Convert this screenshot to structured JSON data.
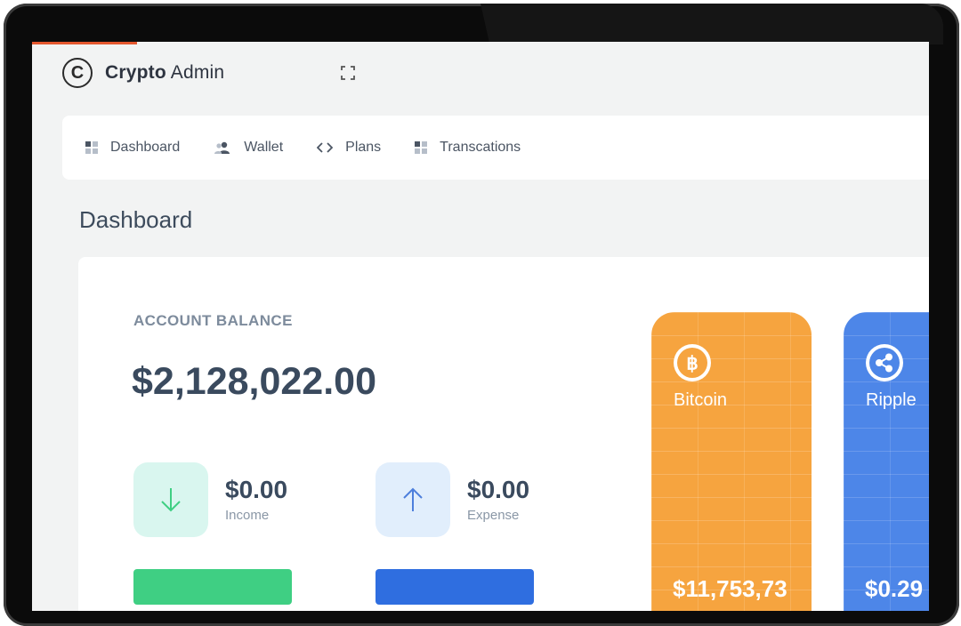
{
  "brand": {
    "name_bold": "Crypto",
    "name_light": "Admin",
    "logo_glyph": "C"
  },
  "header": {
    "fullscreen_icon": "fullscreen-icon"
  },
  "nav": {
    "items": [
      {
        "label": "Dashboard",
        "icon": "grid-icon"
      },
      {
        "label": "Wallet",
        "icon": "users-icon"
      },
      {
        "label": "Plans",
        "icon": "code-icon"
      },
      {
        "label": "Transcations",
        "icon": "grid-icon"
      }
    ]
  },
  "page": {
    "title": "Dashboard"
  },
  "balance": {
    "label": "ACCOUNT BALANCE",
    "value": "$2,128,022.00",
    "income": {
      "value": "$0.00",
      "label": "Income",
      "icon": "arrow-down-icon"
    },
    "expense": {
      "value": "$0.00",
      "label": "Expense",
      "icon": "arrow-up-icon"
    }
  },
  "coins": [
    {
      "name": "Bitcoin",
      "amount": "$11,753,73",
      "icon": "bitcoin-icon",
      "color": "#f6a43f"
    },
    {
      "name": "Ripple",
      "amount": "$0.29",
      "icon": "ripple-icon",
      "color": "#4d86e8"
    }
  ],
  "colors": {
    "income_button": "#3fcf83",
    "expense_button": "#2f6ee0",
    "income_tint": "#d9f6ef",
    "expense_tint": "#e1eefc",
    "accent_red": "#e4572e"
  }
}
